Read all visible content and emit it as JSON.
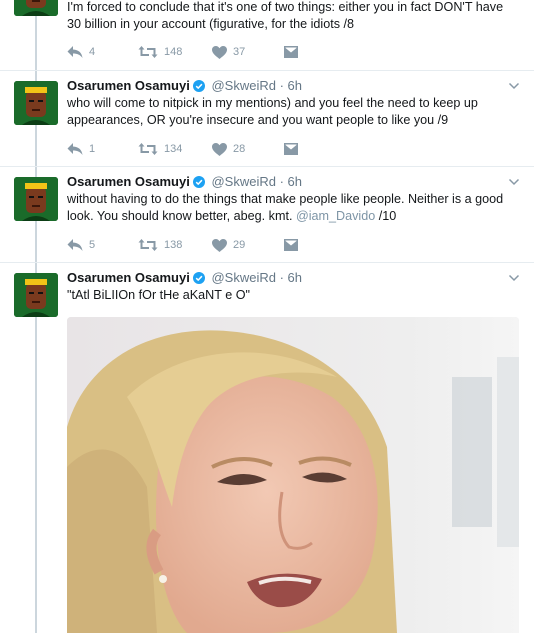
{
  "tweets": [
    {
      "text": "I'm forced to conclude that it's one of two things: either you in fact DON'T have 30 billion in your account (figurative, for the idiots /8",
      "replies": "4",
      "retweets": "148",
      "likes": "37"
    },
    {
      "name": "Osarumen Osamuyi",
      "handle": "@SkweiRd",
      "sep": "·",
      "time": "6h",
      "text": "who will come to nitpick in my mentions) and you feel the need to keep up appearances, OR you're insecure and you want people to like you /9",
      "replies": "1",
      "retweets": "134",
      "likes": "28"
    },
    {
      "name": "Osarumen Osamuyi",
      "handle": "@SkweiRd",
      "sep": "·",
      "time": "6h",
      "text": "without having to do the things that make people like people. Neither is a good look. You should know better, abeg. kmt.",
      "mention": "@iam_Davido",
      "suffix": "/10",
      "replies": "5",
      "retweets": "138",
      "likes": "29"
    },
    {
      "name": "Osarumen Osamuyi",
      "handle": "@SkweiRd",
      "sep": "·",
      "time": "6h",
      "text": "\"tAtl BiLIIOn fOr tHe aKaNT e O\""
    }
  ],
  "colors": {
    "verified": "#1da1f2",
    "meta": "#657786",
    "action": "#8899a6",
    "mention": "#7e95a6",
    "avatar_bg": "#1a6b2a"
  },
  "icons": [
    "reply-icon",
    "retweet-icon",
    "like-icon",
    "direct-message-icon",
    "verified-icon",
    "chevron-down-icon"
  ]
}
